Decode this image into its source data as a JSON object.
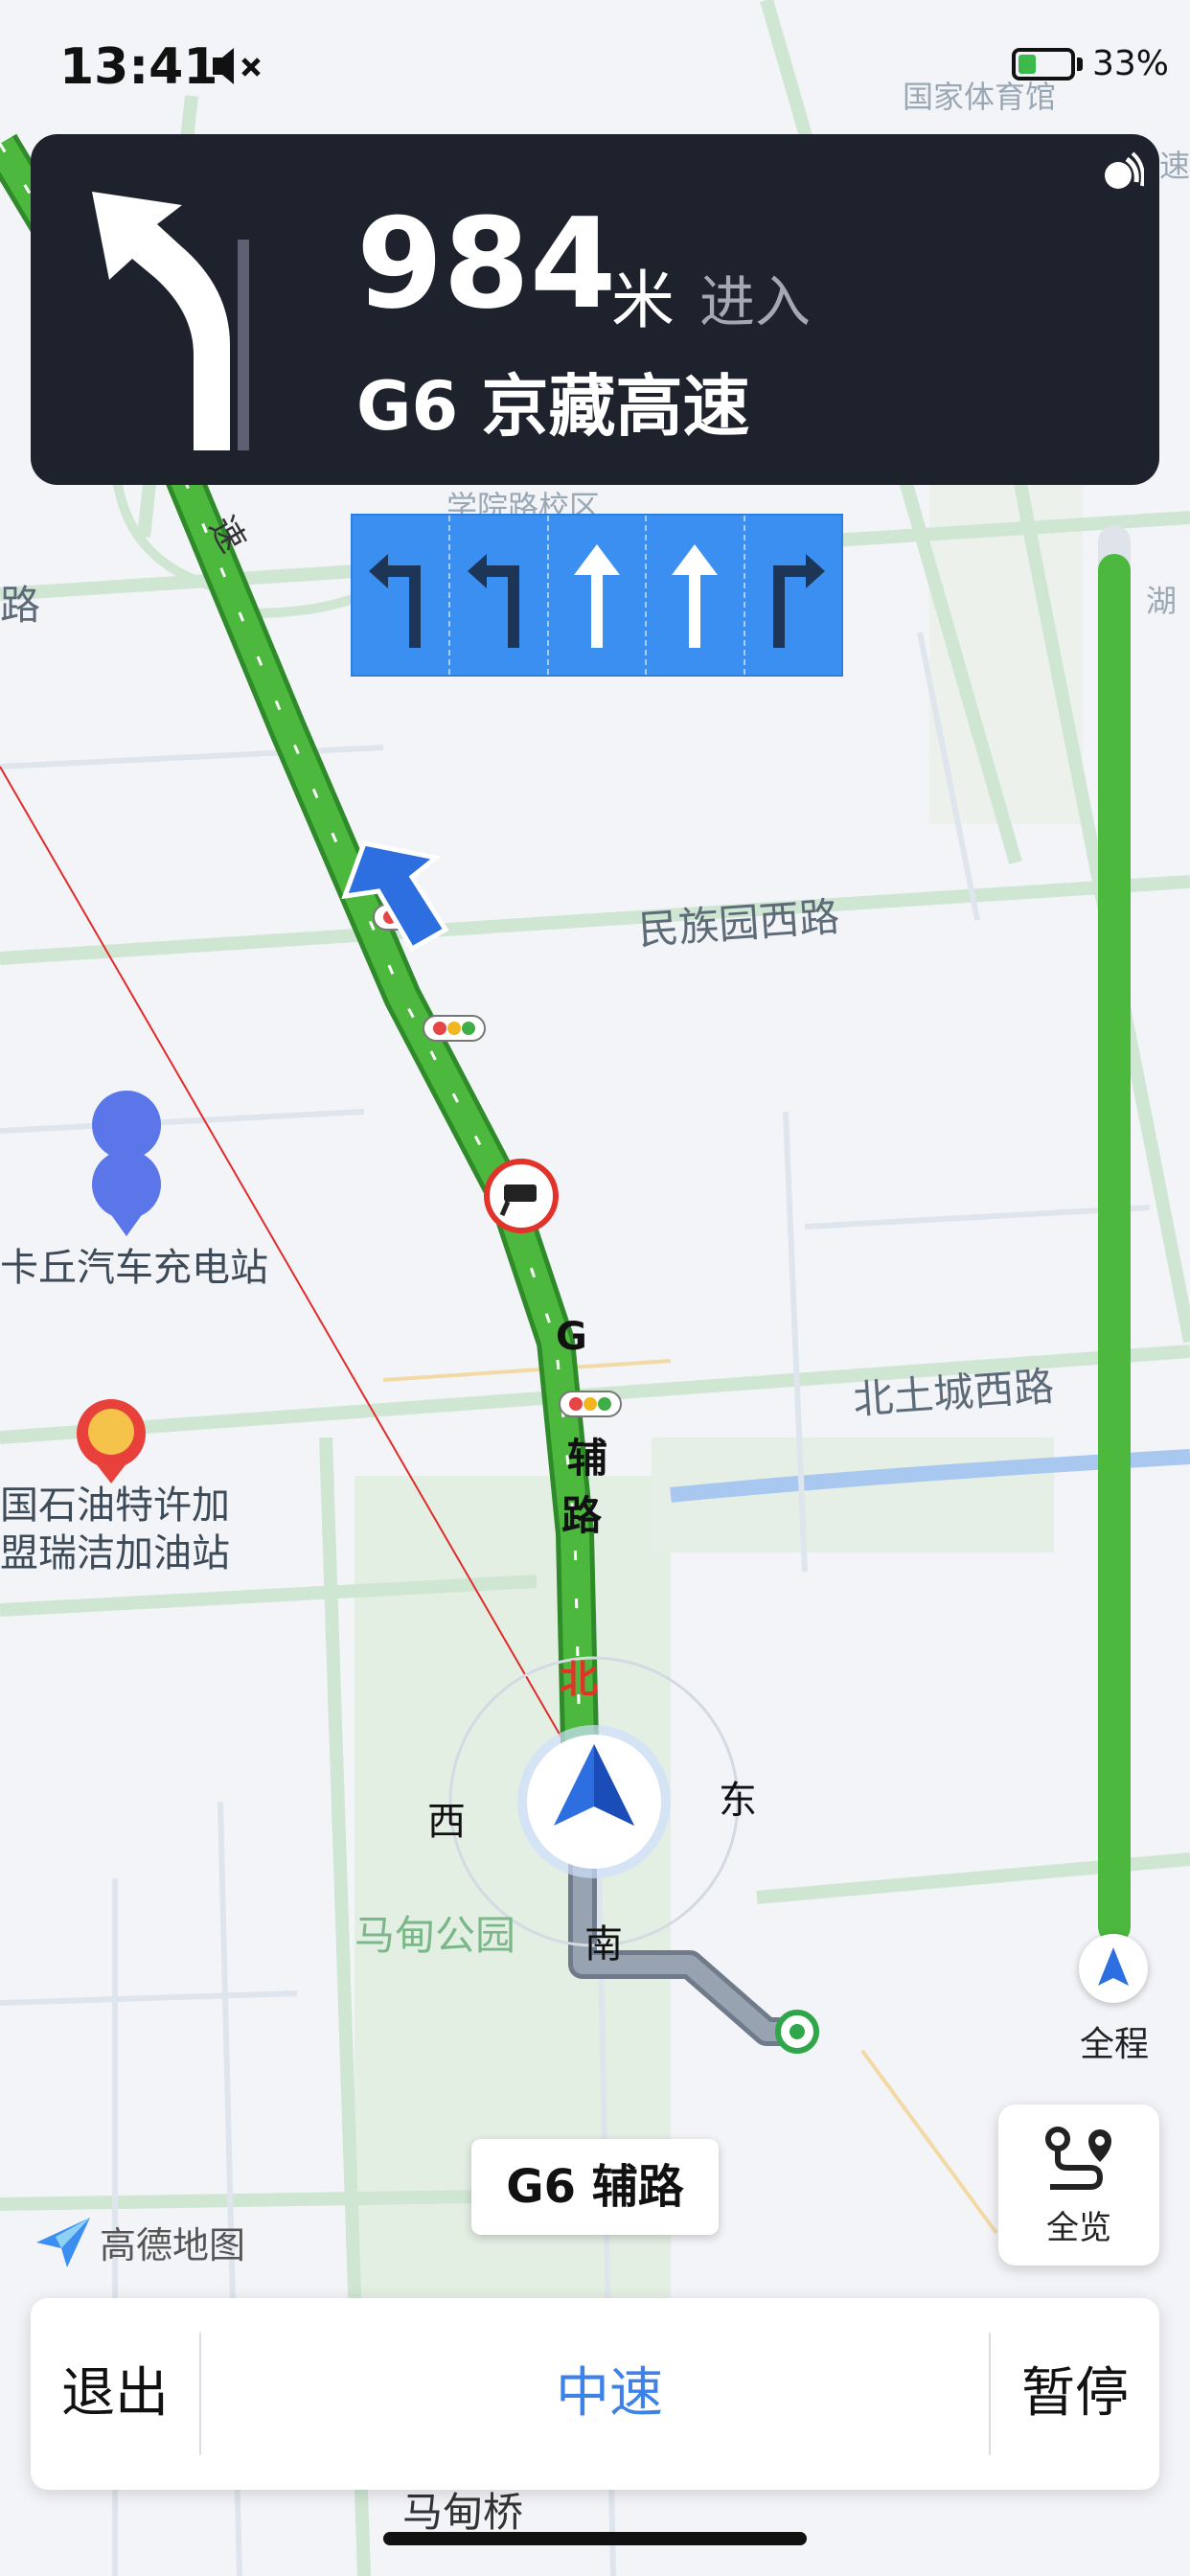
{
  "status_bar": {
    "time": "13:41",
    "battery_percent": "33%",
    "battery_level": 0.33
  },
  "guidance": {
    "distance": "984",
    "unit": "米",
    "action": "进入",
    "road": "G6 京藏高速"
  },
  "lanes": [
    "left-turn-icon",
    "left-turn-icon",
    "straight-icon",
    "straight-icon",
    "right-turn-icon"
  ],
  "map": {
    "labels": {
      "national_sports": "国家体育馆",
      "campus": "学院路校区",
      "minzu_road": "民族园西路",
      "north_tucheng": "北土城西路",
      "madian_park": "马甸公园",
      "madian_bridge": "马甸桥",
      "left_road": "路",
      "right_lake": "湖",
      "highway_fragment": "速",
      "top_right_fragment": "速"
    },
    "pois": {
      "charging_station": "卡丘汽车充电站",
      "gas_station_line1": "国石油特许加",
      "gas_station_line2": "盟瑞洁加油站"
    },
    "route_labels": {
      "g": "G",
      "fu": "辅",
      "lu": "路"
    },
    "compass": {
      "north": "北",
      "south": "南",
      "east": "东",
      "west": "西"
    }
  },
  "progress": {
    "label": "全程",
    "completed_fraction": 0.98
  },
  "overview": {
    "label": "全览"
  },
  "current_road": "G6 辅路",
  "logo": {
    "text": "高德地图"
  },
  "bottom_bar": {
    "exit": "退出",
    "speed": "中速",
    "pause": "暂停"
  },
  "colors": {
    "route_green": "#4cb83e",
    "accent_blue": "#3c82e8",
    "card_dark": "#1e222c",
    "lane_blue": "#3a8ff0"
  }
}
